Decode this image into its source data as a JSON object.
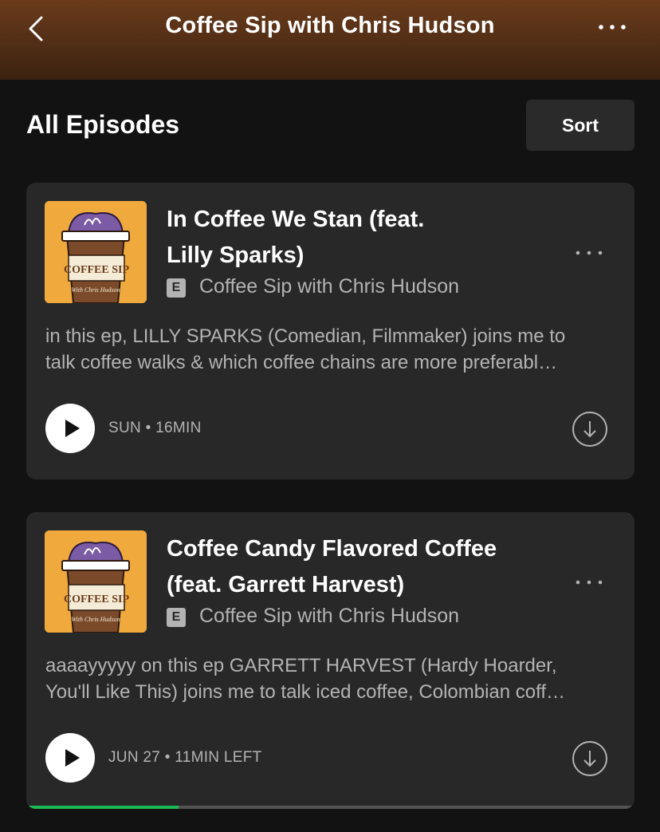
{
  "header": {
    "title": "Coffee Sip with Chris Hudson",
    "back_icon": "chevron-left-icon",
    "more_icon": "more-horizontal-icon"
  },
  "section": {
    "title": "All Episodes",
    "sort_label": "Sort"
  },
  "episodes": [
    {
      "title_line1": "In Coffee We Stan (feat.",
      "title_line2": "Lilly Sparks)",
      "explicit_badge": "E",
      "show": "Coffee Sip with Chris Hudson",
      "desc_line1": "in this ep, LILLY SPARKS (Comedian, Filmmaker) joins me to",
      "desc_line2": "talk coffee walks & which coffee chains are more preferabl…",
      "meta": "SUN • 16MIN",
      "artwork_text": "COFFEE SIP",
      "artwork_subtext": "With Chris Hudson"
    },
    {
      "title_line1": "Coffee Candy Flavored Coffee",
      "title_line2": "(feat. Garrett Harvest)",
      "explicit_badge": "E",
      "show": "Coffee Sip with Chris Hudson",
      "desc_line1": "aaaayyyyy on this ep GARRETT HARVEST (Hardy Hoarder,",
      "desc_line2": "You'll Like This) joins me to talk iced coffee, Colombian coff…",
      "meta": "JUN 27 • 11MIN LEFT",
      "artwork_text": "COFFEE SIP",
      "artwork_subtext": "With Chris Hudson",
      "progress_fraction": 0.25
    }
  ],
  "colors": {
    "header_gradient_top": "#6b3b1b",
    "background": "#121212",
    "card": "#282828",
    "progress": "#1db954"
  }
}
